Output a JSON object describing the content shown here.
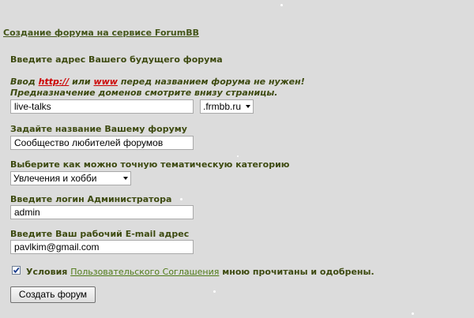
{
  "page_title": "Создание форума на сервисе ForumBB",
  "address_section": {
    "label": "Введите адрес Вашего будущего форума",
    "note_prefix": "Ввод",
    "note_http": "http://",
    "note_or": "или",
    "note_www": "www",
    "note_suffix": "перед названием форума не нужен!",
    "note_line2": "Предназначение доменов смотрите внизу страницы.",
    "address_value": "live-talks",
    "domain_selected": ".frmbb.ru"
  },
  "name_section": {
    "label": "Задайте название Вашему форуму",
    "value": "Сообщество любителей форумов"
  },
  "category_section": {
    "label": "Выберите как можно точную тематическую категорию",
    "selected": "Увлечения и хобби"
  },
  "login_section": {
    "label": "Введите логин Администратора",
    "value": "admin"
  },
  "email_section": {
    "label": "Введите Ваш рабочий E-mail адрес",
    "value": "pavlkim@gmail.com"
  },
  "agreement": {
    "checked": true,
    "prefix": "Условия",
    "link": "Пользовательского Соглашения",
    "suffix": "мною прочитаны и одобрены."
  },
  "submit_label": "Создать форум",
  "colors": {
    "background": "#dcdcdc",
    "label_text": "#3d4a10",
    "warning_red": "#cc0000",
    "link_green": "#4f7a18"
  }
}
